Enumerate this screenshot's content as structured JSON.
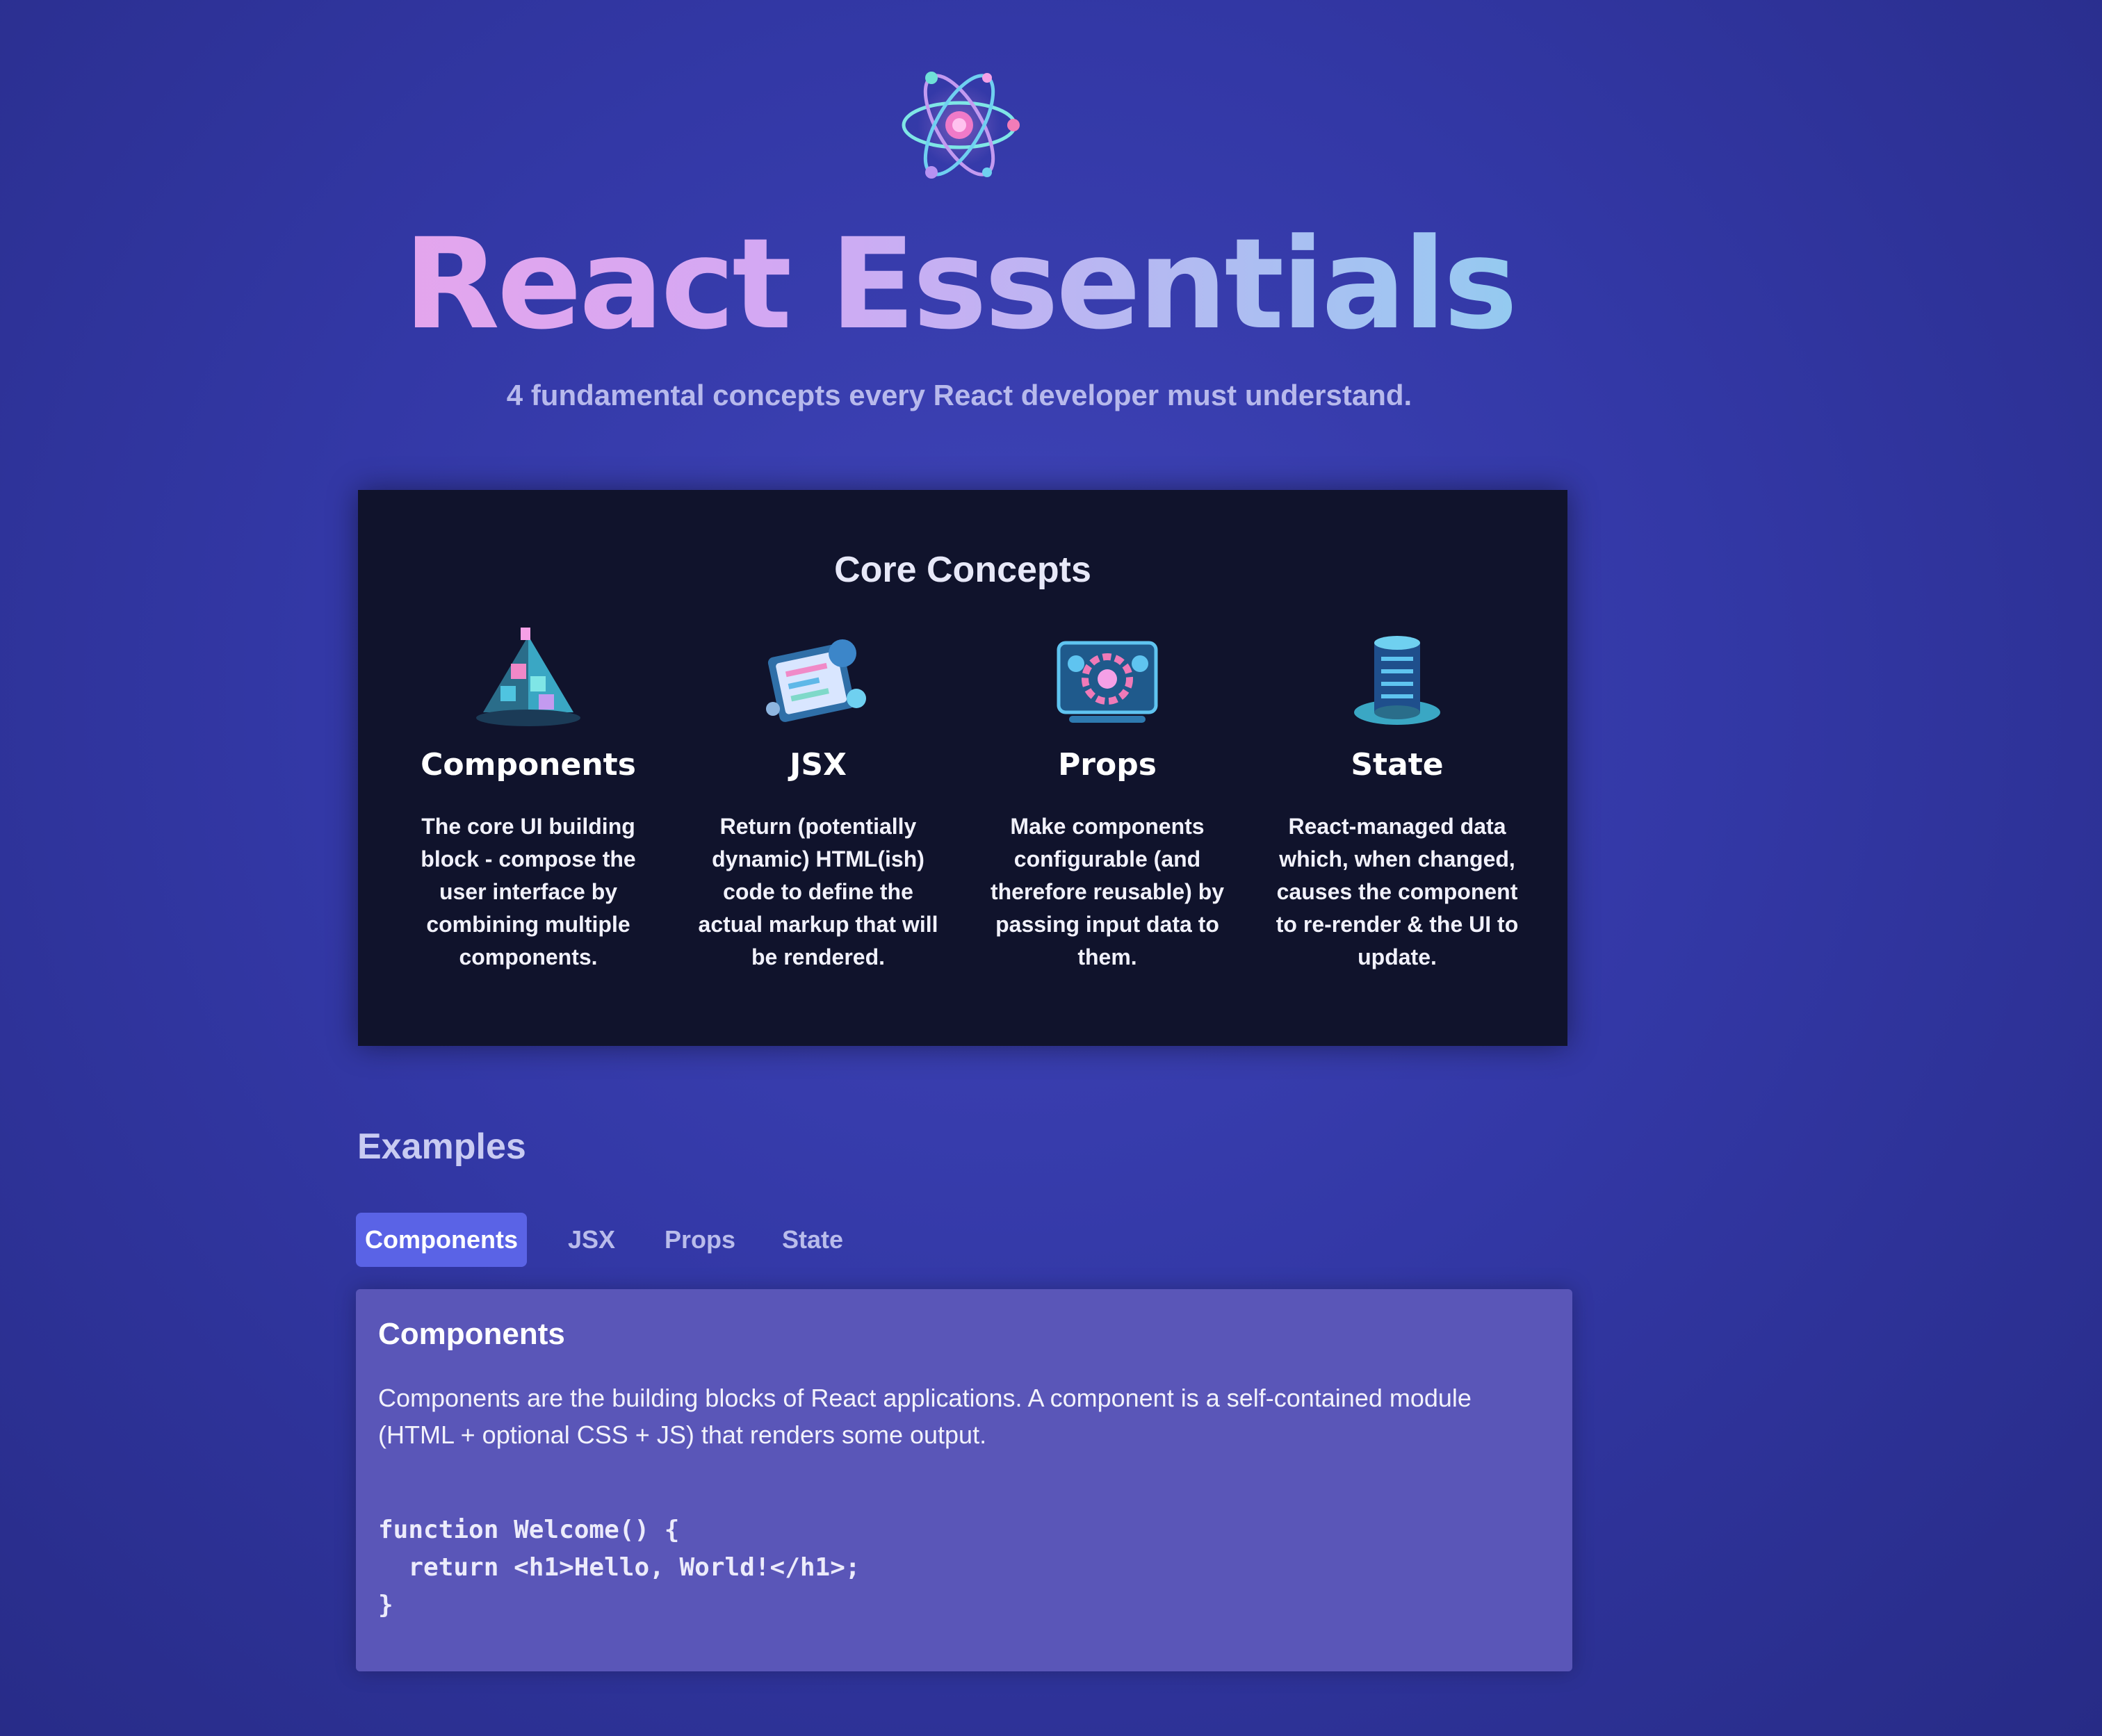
{
  "header": {
    "logo_icon": "react-atom-icon",
    "title": "React Essentials",
    "subtitle": "4 fundamental concepts every React developer must understand."
  },
  "core_concepts": {
    "title": "Core Concepts",
    "items": [
      {
        "icon": "components-blocks-icon",
        "title": "Components",
        "description": "The core UI building block - compose the user interface by combining multiple components."
      },
      {
        "icon": "jsx-code-icon",
        "title": "JSX",
        "description": "Return (potentially dynamic) HTML(ish) code to define the actual markup that will be rendered."
      },
      {
        "icon": "props-config-icon",
        "title": "Props",
        "description": "Make components configurable (and therefore reusable) by passing input data to them."
      },
      {
        "icon": "state-data-icon",
        "title": "State",
        "description": "React-managed data which, when changed, causes the component to re-render & the UI to update."
      }
    ]
  },
  "examples": {
    "title": "Examples",
    "tabs": [
      {
        "label": "Components",
        "active": true
      },
      {
        "label": "JSX",
        "active": false
      },
      {
        "label": "Props",
        "active": false
      },
      {
        "label": "State",
        "active": false
      }
    ],
    "content": {
      "title": "Components",
      "description": "Components are the building blocks of React applications. A component is a self-contained module (HTML + optional CSS + JS) that renders some output.",
      "code": "function Welcome() {\n  return <h1>Hello, World!</h1>;\n}"
    }
  },
  "colors": {
    "background": "#3338a6",
    "panel_dark": "#10132c",
    "tab_active": "#5a63e6",
    "content_panel": "#5a56b8",
    "title_gradient_start": "#f7a2e6",
    "title_gradient_end": "#58dfe0"
  }
}
